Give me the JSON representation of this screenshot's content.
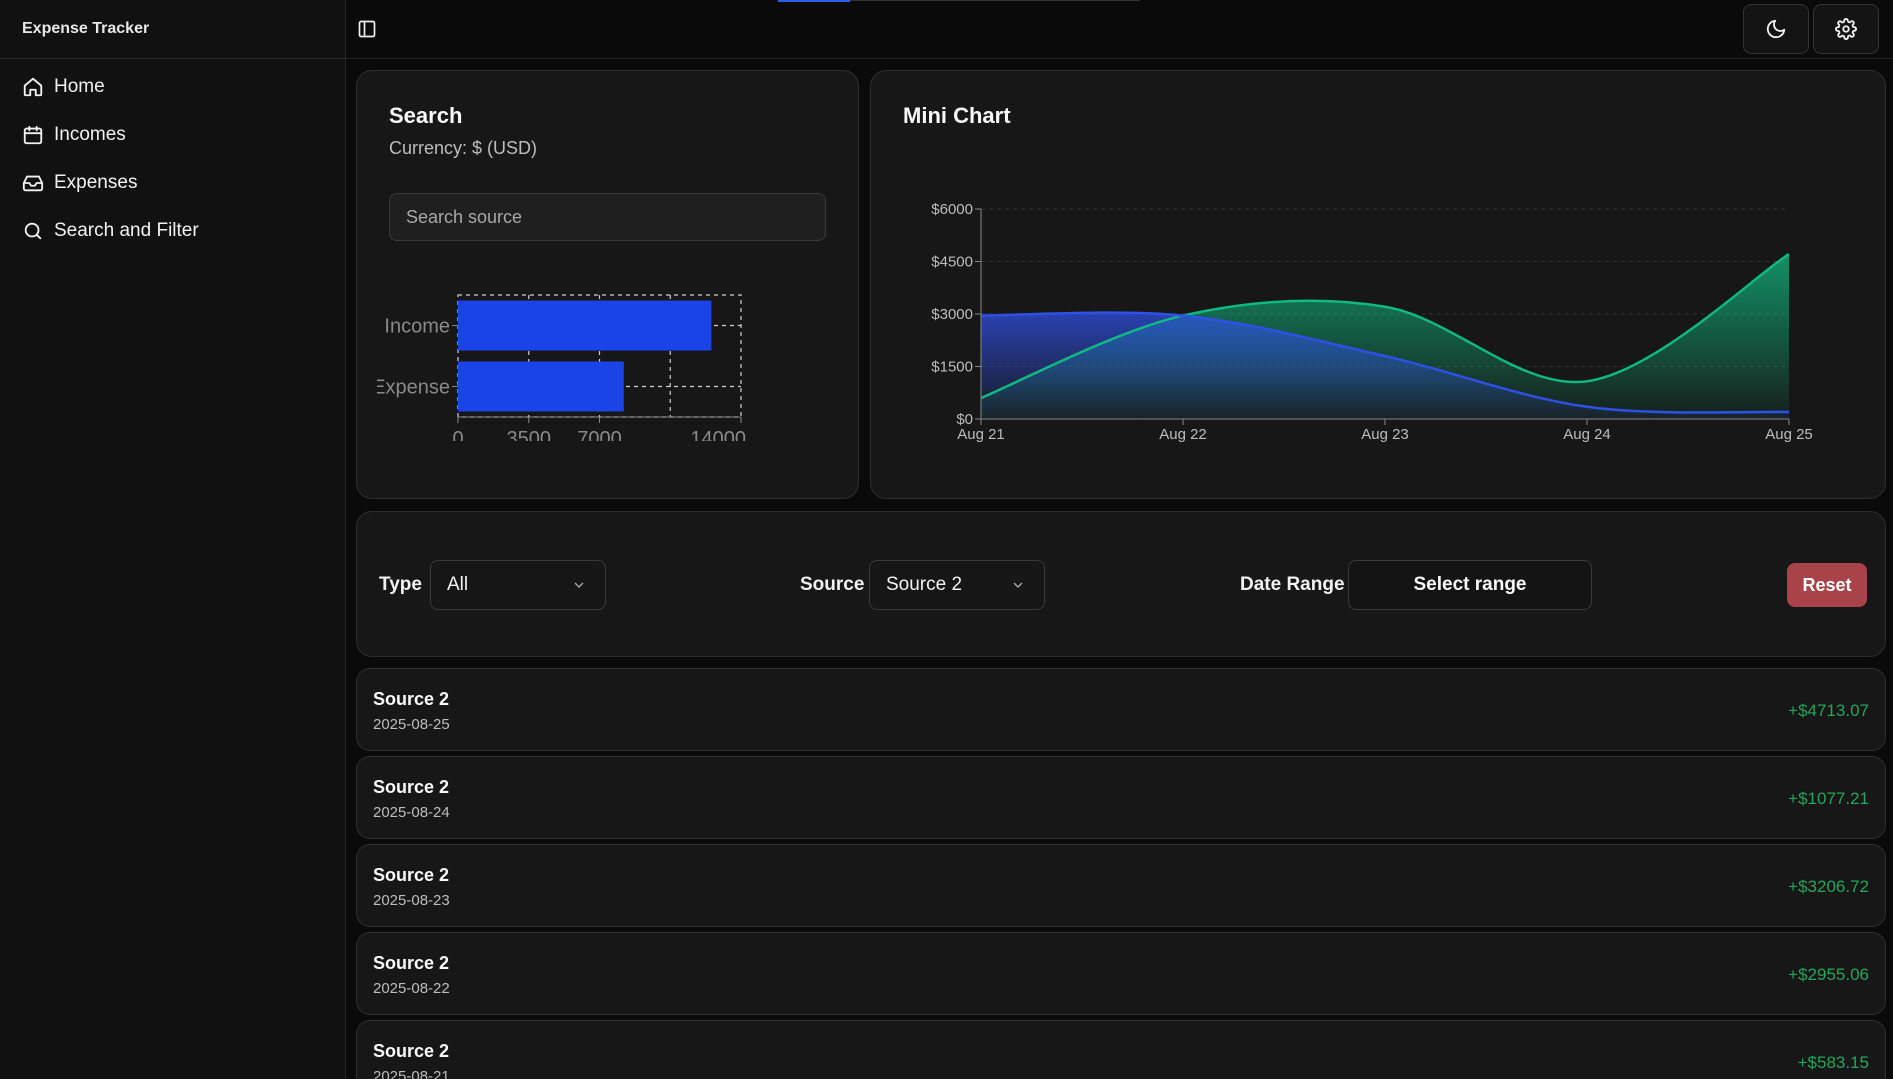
{
  "sidebar": {
    "brand": "Expense Tracker",
    "items": [
      {
        "label": "Home",
        "icon": "home-icon"
      },
      {
        "label": "Incomes",
        "icon": "calendar-icon"
      },
      {
        "label": "Expenses",
        "icon": "inbox-icon"
      },
      {
        "label": "Search and Filter",
        "icon": "search-icon"
      }
    ]
  },
  "topbar": {
    "toggle_icon": "sidebar-toggle-icon",
    "theme_icon": "moon-icon",
    "settings_icon": "gear-icon"
  },
  "search_card": {
    "title": "Search",
    "currency": "Currency: $ (USD)",
    "search_placeholder": "Search source"
  },
  "bar_chart": {
    "type": "bar",
    "orientation": "horizontal",
    "categories": [
      "Income",
      "Expense"
    ],
    "values": [
      12535,
      8200
    ],
    "xticks": [
      0,
      3500,
      7000,
      14000
    ],
    "xlim": [
      0,
      14000
    ],
    "color": "#1a44e8",
    "grid": true
  },
  "chart_card": {
    "title": "Mini Chart"
  },
  "chart_data": {
    "type": "area",
    "categories": [
      "Aug 21",
      "Aug 22",
      "Aug 23",
      "Aug 24",
      "Aug 25"
    ],
    "yticks": [
      "$0",
      "$1500",
      "$3000",
      "$4500",
      "$6000"
    ],
    "ylim": [
      0,
      6000
    ],
    "grid": true,
    "series": [
      {
        "values": [
          600,
          2955,
          3207,
          1077,
          4713
        ],
        "color": "#10b981"
      },
      {
        "values": [
          2955,
          2955,
          1800,
          350,
          200
        ],
        "color": "#2f50e6"
      }
    ]
  },
  "filters": {
    "type_label": "Type",
    "type_value": "All",
    "source_label": "Source",
    "source_value": "Source 2",
    "date_label": "Date Range",
    "date_button": "Select range",
    "reset_label": "Reset",
    "reset_color": "#a8434a"
  },
  "transactions": [
    {
      "source": "Source 2",
      "date": "2025-08-25",
      "amount": "+$4713.07"
    },
    {
      "source": "Source 2",
      "date": "2025-08-24",
      "amount": "+$1077.21"
    },
    {
      "source": "Source 2",
      "date": "2025-08-23",
      "amount": "+$3206.72"
    },
    {
      "source": "Source 2",
      "date": "2025-08-22",
      "amount": "+$2955.06"
    },
    {
      "source": "Source 2",
      "date": "2025-08-21",
      "amount": "+$583.15"
    }
  ],
  "colors": {
    "accent": "#2563eb",
    "positive": "#22a75b",
    "background": "#0a0a0a",
    "card": "#171717"
  }
}
